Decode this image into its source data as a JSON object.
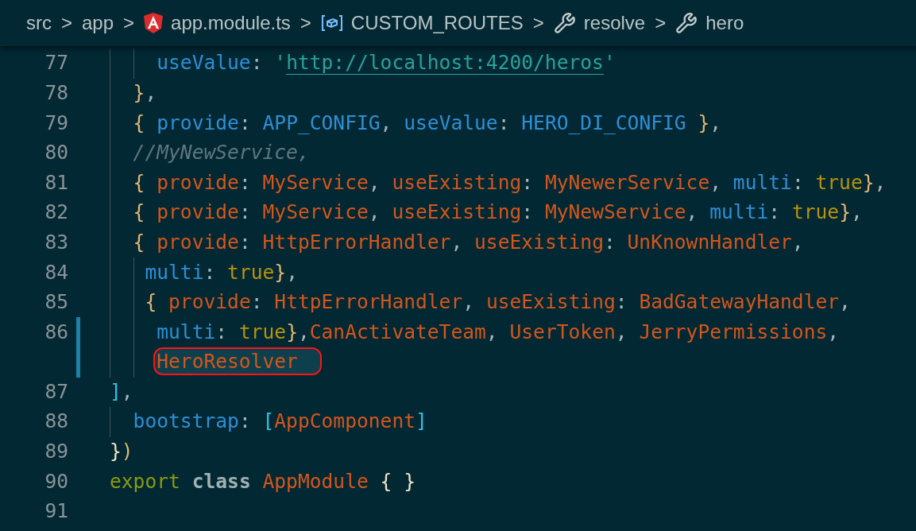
{
  "breadcrumbs": [
    {
      "label": "src"
    },
    {
      "label": "app"
    },
    {
      "label": "app.module.ts",
      "kind": "angular"
    },
    {
      "label": "CUSTOM_ROUTES",
      "kind": "variable"
    },
    {
      "label": "resolve",
      "kind": "wrench"
    },
    {
      "label": "hero",
      "kind": "wrench"
    }
  ],
  "separator": ">",
  "lines": [
    {
      "number": "77",
      "modified": false,
      "rows": [
        [
          {
            "t": "    useValue",
            "kind": "prop"
          },
          {
            "t": ": ",
            "kind": "punct"
          },
          {
            "t": "'",
            "kind": "string"
          },
          {
            "t": "http://localhost:4200/heros",
            "kind": "link"
          },
          {
            "t": "'",
            "kind": "string"
          }
        ]
      ]
    },
    {
      "number": "78",
      "modified": false,
      "rows": [
        [
          {
            "t": "  }",
            "kind": "brace"
          },
          {
            "t": ",",
            "kind": "punct"
          }
        ]
      ]
    },
    {
      "number": "79",
      "modified": false,
      "rows": [
        [
          {
            "t": "  {",
            "kind": "brace"
          },
          {
            "t": " provide",
            "kind": "prop"
          },
          {
            "t": ": ",
            "kind": "punct"
          },
          {
            "t": "APP_CONFIG",
            "kind": "prop"
          },
          {
            "t": ", ",
            "kind": "punct"
          },
          {
            "t": "useValue",
            "kind": "prop"
          },
          {
            "t": ": ",
            "kind": "punct"
          },
          {
            "t": "HERO_DI_CONFIG",
            "kind": "prop"
          },
          {
            "t": " }",
            "kind": "brace"
          },
          {
            "t": ",",
            "kind": "punct"
          }
        ]
      ]
    },
    {
      "number": "80",
      "modified": false,
      "rows": [
        [
          {
            "t": "  //MyNewService,",
            "kind": "comment"
          }
        ]
      ]
    },
    {
      "number": "81",
      "modified": false,
      "rows": [
        [
          {
            "t": "  {",
            "kind": "brace"
          },
          {
            "t": " provide",
            "kind": "name"
          },
          {
            "t": ": ",
            "kind": "punct"
          },
          {
            "t": "MyService",
            "kind": "name"
          },
          {
            "t": ", ",
            "kind": "punct"
          },
          {
            "t": "useExisting",
            "kind": "name"
          },
          {
            "t": ": ",
            "kind": "punct"
          },
          {
            "t": "MyNewerService",
            "kind": "name"
          },
          {
            "t": ", ",
            "kind": "punct"
          },
          {
            "t": "multi",
            "kind": "prop"
          },
          {
            "t": ": ",
            "kind": "punct"
          },
          {
            "t": "true",
            "kind": "bool"
          },
          {
            "t": "}",
            "kind": "brace"
          },
          {
            "t": ",",
            "kind": "punct"
          }
        ]
      ]
    },
    {
      "number": "82",
      "modified": false,
      "rows": [
        [
          {
            "t": "  {",
            "kind": "brace"
          },
          {
            "t": " provide",
            "kind": "name"
          },
          {
            "t": ": ",
            "kind": "punct"
          },
          {
            "t": "MyService",
            "kind": "name"
          },
          {
            "t": ", ",
            "kind": "punct"
          },
          {
            "t": "useExisting",
            "kind": "name"
          },
          {
            "t": ": ",
            "kind": "punct"
          },
          {
            "t": "MyNewService",
            "kind": "name"
          },
          {
            "t": ", ",
            "kind": "punct"
          },
          {
            "t": "multi",
            "kind": "prop"
          },
          {
            "t": ": ",
            "kind": "punct"
          },
          {
            "t": "true",
            "kind": "bool"
          },
          {
            "t": "}",
            "kind": "brace"
          },
          {
            "t": ",",
            "kind": "punct"
          }
        ]
      ]
    },
    {
      "number": "83",
      "modified": false,
      "rows": [
        [
          {
            "t": "  {",
            "kind": "brace"
          },
          {
            "t": " provide",
            "kind": "name"
          },
          {
            "t": ": ",
            "kind": "punct"
          },
          {
            "t": "HttpErrorHandler",
            "kind": "name"
          },
          {
            "t": ", ",
            "kind": "punct"
          },
          {
            "t": "useExisting",
            "kind": "name"
          },
          {
            "t": ": ",
            "kind": "punct"
          },
          {
            "t": "UnKnownHandler",
            "kind": "name"
          },
          {
            "t": ",",
            "kind": "punct"
          }
        ]
      ]
    },
    {
      "number": "84",
      "modified": false,
      "rows": [
        [
          {
            "t": "   multi",
            "kind": "prop"
          },
          {
            "t": ": ",
            "kind": "punct"
          },
          {
            "t": "true",
            "kind": "bool"
          },
          {
            "t": "}",
            "kind": "brace"
          },
          {
            "t": ",",
            "kind": "punct"
          }
        ]
      ]
    },
    {
      "number": "85",
      "modified": false,
      "rows": [
        [
          {
            "t": "   {",
            "kind": "brace"
          },
          {
            "t": " provide",
            "kind": "name"
          },
          {
            "t": ": ",
            "kind": "punct"
          },
          {
            "t": "HttpErrorHandler",
            "kind": "name"
          },
          {
            "t": ", ",
            "kind": "punct"
          },
          {
            "t": "useExisting",
            "kind": "name"
          },
          {
            "t": ": ",
            "kind": "punct"
          },
          {
            "t": "BadGatewayHandler",
            "kind": "name"
          },
          {
            "t": ",",
            "kind": "punct"
          }
        ]
      ]
    },
    {
      "number": "86",
      "modified": true,
      "rows": [
        [
          {
            "t": "    multi",
            "kind": "prop"
          },
          {
            "t": ": ",
            "kind": "punct"
          },
          {
            "t": "true",
            "kind": "bool"
          },
          {
            "t": "}",
            "kind": "brace"
          },
          {
            "t": ",",
            "kind": "punct"
          },
          {
            "t": "CanActivateTeam",
            "kind": "name"
          },
          {
            "t": ", ",
            "kind": "punct"
          },
          {
            "t": "UserToken",
            "kind": "name"
          },
          {
            "t": ", ",
            "kind": "punct"
          },
          {
            "t": "JerryPermissions",
            "kind": "name"
          },
          {
            "t": ",",
            "kind": "punct"
          }
        ],
        [
          {
            "t": "HeroResolver",
            "kind": "name",
            "boxed": true
          }
        ]
      ]
    },
    {
      "number": "87",
      "modified": false,
      "rows": [
        [
          {
            "t": "]",
            "kind": "bracket"
          },
          {
            "t": ",",
            "kind": "punct"
          }
        ]
      ]
    },
    {
      "number": "88",
      "modified": false,
      "rows": [
        [
          {
            "t": "  bootstrap",
            "kind": "prop"
          },
          {
            "t": ": ",
            "kind": "punct"
          },
          {
            "t": "[",
            "kind": "bracket"
          },
          {
            "t": "AppComponent",
            "kind": "name"
          },
          {
            "t": "]",
            "kind": "bracket"
          }
        ]
      ]
    },
    {
      "number": "89",
      "modified": false,
      "rows": [
        [
          {
            "t": "}",
            "kind": "light"
          },
          {
            "t": ")",
            "kind": "brace"
          }
        ]
      ]
    },
    {
      "number": "90",
      "modified": false,
      "rows": [
        [
          {
            "t": "export",
            "kind": "keyword"
          },
          {
            "t": " class",
            "kind": "storage"
          },
          {
            "t": " AppModule",
            "kind": "name"
          },
          {
            "t": " { }",
            "kind": "light"
          }
        ]
      ]
    },
    {
      "number": "91",
      "modified": false
    }
  ]
}
